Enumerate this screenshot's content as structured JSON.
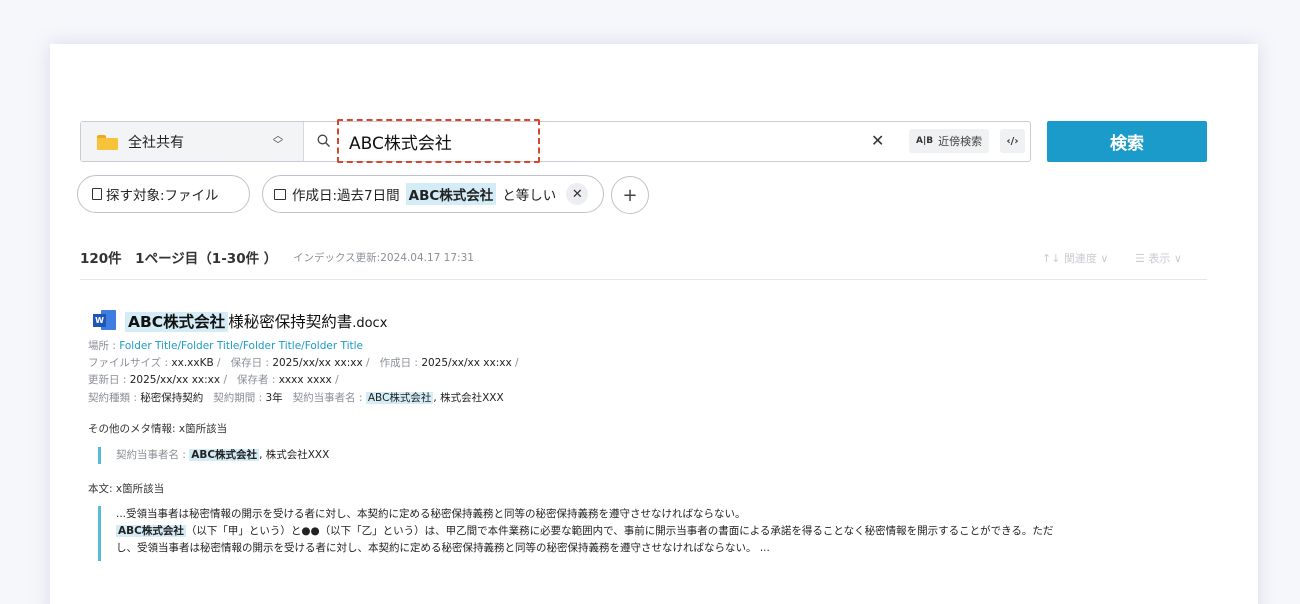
{
  "search": {
    "scope_label": "全社共有",
    "query": "ABC株式会社",
    "nearby_label": "近傍検索",
    "nearby_icon_text": "A|B",
    "code_icon_text": "‹/›",
    "button_label": "検索"
  },
  "filters": {
    "target_label": "探す対象:ファイル",
    "date_prefix": "作成日:過去7日間",
    "date_value": "ABC株式会社",
    "date_suffix": "と等しい"
  },
  "results_header": {
    "summary": "120件　1ページ目（1-30件 ）",
    "index_updated": "インデックス更新:2024.04.17 17:31",
    "sort_label": "関連度",
    "view_label": "表示"
  },
  "result": {
    "title_highlight": "ABC株式会社",
    "title_rest": "様秘密保持契約書",
    "title_ext": ".docx",
    "location_label": "場所 : ",
    "location": "Folder Title/Folder Title/Folder Title/Folder Title",
    "filesize_label": "ファイルサイズ : ",
    "filesize": "xx.xxKB",
    "saved_date_label": "保存日 : ",
    "saved_date": "2025/xx/xx xx:xx",
    "created_date_label": "作成日 : ",
    "created_date": "2025/xx/xx xx:xx",
    "updated_date_label": "更新日 : ",
    "updated_date": "2025/xx/xx xx:xx",
    "saver_label": "保存者 : ",
    "saver": "xxxx xxxx",
    "contract_type_label": "契約種類 : ",
    "contract_type": "秘密保持契約",
    "contract_period_label": "契約期間 : ",
    "contract_period": "3年",
    "parties_label": "契約当事者名 : ",
    "party1": "ABC株式会社",
    "party2": ", 株式会社XXX",
    "other_meta_label": "その他のメタ情報: x箇所該当",
    "other_meta_field_label": "契約当事者名 : ",
    "other_meta_party1": "ABC株式会社",
    "other_meta_party2": ", 株式会社XXX",
    "body_label": "本文: x箇所該当",
    "body_line1": "...受領当事者は秘密情報の開示を受ける者に対し、本契約に定める秘密保持義務と同等の秘密保持義務を遵守させなければならない。",
    "body_line2_highlight": "ABC株式会社",
    "body_line2_rest": "（以下「甲」という）と●●（以下「乙」という）は、甲乙間で本件業務に必要な範囲内で、事前に開示当事者の書面による承諾を得ることなく秘密情報を開示することができる。ただ",
    "body_line3": "し、受領当事者は秘密情報の開示を受ける者に対し、本契約に定める秘密保持義務と同等の秘密保持義務を遵守させなければならない。 ..."
  },
  "colors": {
    "accent": "#1a9bc9",
    "highlight": "#d4ecf6",
    "focus_dash": "#d9462e",
    "quote_bar": "#59b9d6"
  },
  "icons": [
    "folder-icon",
    "updown-icon",
    "search-icon",
    "clear-icon",
    "code-icon",
    "document-icon",
    "calendar-icon",
    "close-icon",
    "plus-icon",
    "sort-icon",
    "list-icon",
    "chevron-down-icon",
    "word-file-icon"
  ]
}
